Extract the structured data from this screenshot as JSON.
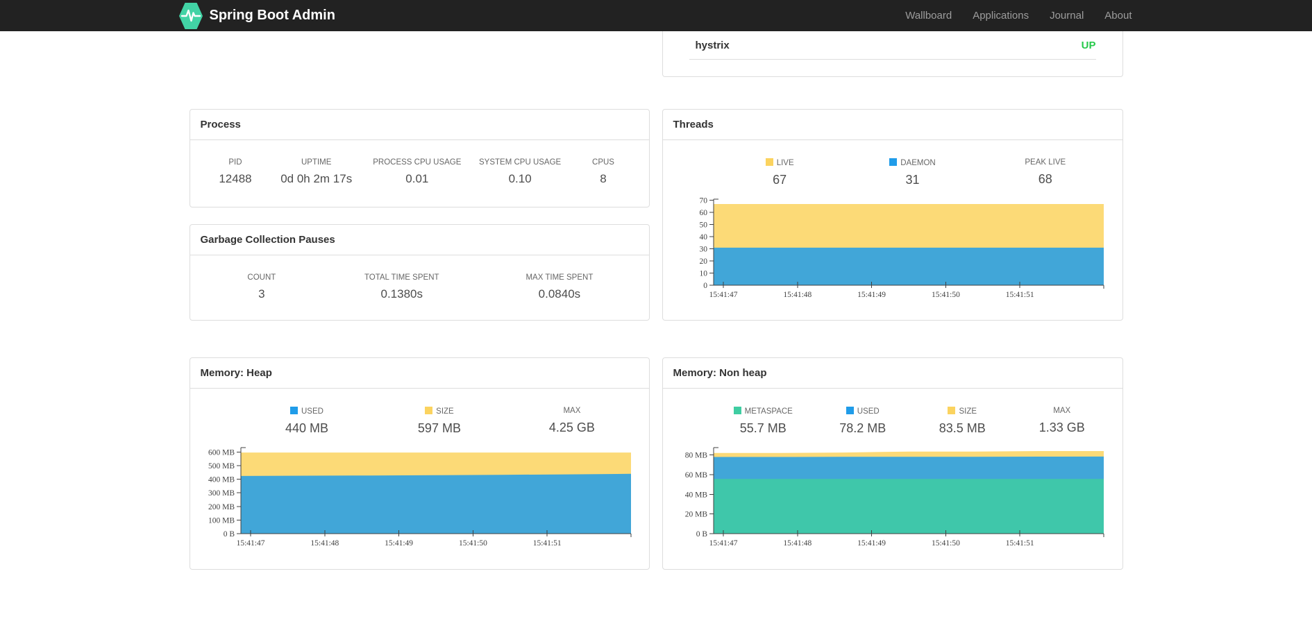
{
  "navbar": {
    "brand": "Spring Boot Admin",
    "items": [
      {
        "label": "Wallboard"
      },
      {
        "label": "Applications"
      },
      {
        "label": "Journal"
      },
      {
        "label": "About"
      }
    ]
  },
  "application": {
    "name": "hystrix",
    "status": "UP",
    "status_color": "#26c94a"
  },
  "panels": {
    "process": {
      "title": "Process",
      "metrics": [
        {
          "label": "PID",
          "value": "12488"
        },
        {
          "label": "UPTIME",
          "value": "0d 0h 2m 17s"
        },
        {
          "label": "PROCESS CPU USAGE",
          "value": "0.01"
        },
        {
          "label": "SYSTEM CPU USAGE",
          "value": "0.10"
        },
        {
          "label": "CPUS",
          "value": "8"
        }
      ]
    },
    "gc": {
      "title": "Garbage Collection Pauses",
      "metrics": [
        {
          "label": "COUNT",
          "value": "3"
        },
        {
          "label": "TOTAL TIME SPENT",
          "value": "0.1380s"
        },
        {
          "label": "MAX TIME SPENT",
          "value": "0.0840s"
        }
      ]
    },
    "threads": {
      "title": "Threads",
      "metrics": [
        {
          "label": "LIVE",
          "value": "67",
          "color": "#fbd35f"
        },
        {
          "label": "DAEMON",
          "value": "31",
          "color": "#209ce9"
        },
        {
          "label": "PEAK LIVE",
          "value": "68"
        }
      ]
    },
    "heap": {
      "title": "Memory: Heap",
      "metrics": [
        {
          "label": "USED",
          "value": "440 MB",
          "color": "#209ce9"
        },
        {
          "label": "SIZE",
          "value": "597 MB",
          "color": "#fbd35f"
        },
        {
          "label": "MAX",
          "value": "4.25 GB"
        }
      ]
    },
    "nonheap": {
      "title": "Memory: Non heap",
      "metrics": [
        {
          "label": "METASPACE",
          "value": "55.7 MB",
          "color": "#3fcda2"
        },
        {
          "label": "USED",
          "value": "78.2 MB",
          "color": "#209ce9"
        },
        {
          "label": "SIZE",
          "value": "83.5 MB",
          "color": "#fbd35f"
        },
        {
          "label": "MAX",
          "value": "1.33 GB"
        }
      ]
    }
  },
  "chart_data": [
    {
      "id": "threads",
      "type": "area",
      "title": "Threads",
      "x_labels": [
        "15:41:47",
        "15:41:48",
        "15:41:49",
        "15:41:50",
        "15:41:51"
      ],
      "ylim": [
        0,
        71
      ],
      "y_ticks": [
        {
          "value": 0,
          "label": "0"
        },
        {
          "value": 10,
          "label": "10"
        },
        {
          "value": 20,
          "label": "20"
        },
        {
          "value": 30,
          "label": "30"
        },
        {
          "value": 40,
          "label": "40"
        },
        {
          "value": 50,
          "label": "50"
        },
        {
          "value": 60,
          "label": "60"
        },
        {
          "value": 70,
          "label": "70"
        }
      ],
      "series": [
        {
          "name": "LIVE",
          "color": "#fbd35f",
          "values": [
            67,
            67,
            67,
            67,
            67,
            67,
            67
          ]
        },
        {
          "name": "DAEMON",
          "color": "#209ce9",
          "values": [
            31,
            31,
            31,
            31,
            31,
            31,
            31
          ]
        }
      ],
      "legend_position": "top",
      "grid": false
    },
    {
      "id": "heap",
      "type": "area",
      "title": "Memory: Heap",
      "x_labels": [
        "15:41:47",
        "15:41:48",
        "15:41:49",
        "15:41:50",
        "15:41:51"
      ],
      "ylim": [
        0,
        633
      ],
      "unit": "MB",
      "y_ticks": [
        {
          "value": 0,
          "label": "0 B"
        },
        {
          "value": 100,
          "label": "100 MB"
        },
        {
          "value": 200,
          "label": "200 MB"
        },
        {
          "value": 300,
          "label": "300 MB"
        },
        {
          "value": 400,
          "label": "400 MB"
        },
        {
          "value": 500,
          "label": "500 MB"
        },
        {
          "value": 600,
          "label": "600 MB"
        }
      ],
      "series": [
        {
          "name": "SIZE",
          "color": "#fbd35f",
          "values": [
            597,
            597,
            597,
            597,
            597,
            597,
            597
          ]
        },
        {
          "name": "USED",
          "color": "#209ce9",
          "values": [
            424,
            426,
            428,
            430,
            433,
            436,
            440
          ]
        }
      ],
      "legend_position": "top",
      "grid": false
    },
    {
      "id": "nonheap",
      "type": "area",
      "title": "Memory: Non heap",
      "x_labels": [
        "15:41:47",
        "15:41:48",
        "15:41:49",
        "15:41:50",
        "15:41:51"
      ],
      "ylim": [
        0,
        87.5
      ],
      "unit": "MB",
      "y_ticks": [
        {
          "value": 0,
          "label": "0 B"
        },
        {
          "value": 20,
          "label": "20 MB"
        },
        {
          "value": 40,
          "label": "40 MB"
        },
        {
          "value": 60,
          "label": "60 MB"
        },
        {
          "value": 80,
          "label": "80 MB"
        }
      ],
      "series": [
        {
          "name": "SIZE",
          "color": "#fbd35f",
          "values": [
            82,
            82,
            82.5,
            83.5,
            83.5,
            84,
            84
          ]
        },
        {
          "name": "USED",
          "color": "#209ce9",
          "values": [
            78,
            78,
            78.1,
            78.2,
            78.2,
            78.3,
            78.4
          ]
        },
        {
          "name": "METASPACE",
          "color": "#3fcda2",
          "values": [
            55.7,
            55.7,
            55.7,
            55.7,
            55.7,
            55.7,
            55.7
          ]
        }
      ],
      "legend_position": "top",
      "grid": false
    }
  ],
  "colors": {
    "navbar_bg": "#222222",
    "nav_link": "#9d9d9d",
    "logo_green": "#42d3a5",
    "panel_border": "#dddddd",
    "series_yellow": "#fbd35f",
    "series_blue": "#209ce9",
    "series_green": "#3fcda2",
    "status_up": "#26c94a"
  }
}
